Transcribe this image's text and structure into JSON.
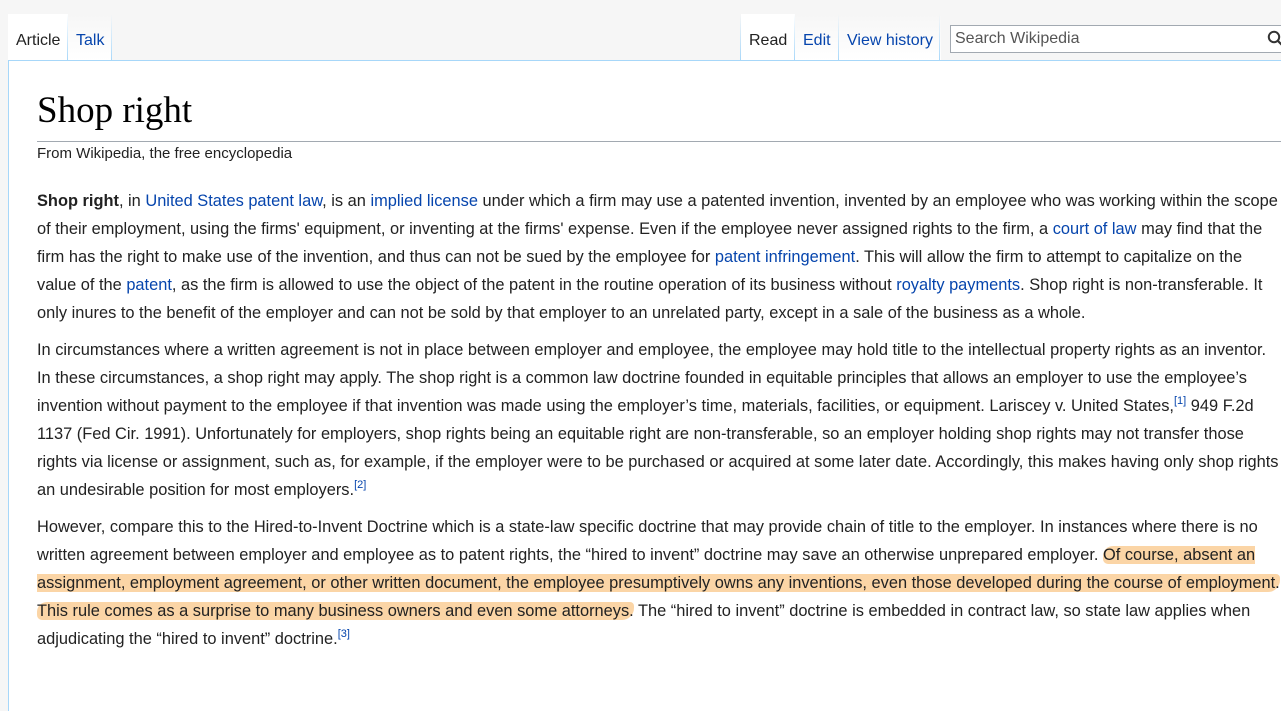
{
  "tabs": {
    "article": "Article",
    "talk": "Talk",
    "read": "Read",
    "edit": "Edit",
    "view_history": "View history"
  },
  "search": {
    "placeholder": "Search Wikipedia",
    "icon": "search-icon"
  },
  "page": {
    "title": "Shop right",
    "tagline": "From Wikipedia, the free encyclopedia"
  },
  "p1": {
    "bold": "Shop right",
    "t1": ", in ",
    "link_patent_law": "United States patent law",
    "t2": ", is an ",
    "link_implied_license": "implied license",
    "t3": " under which a firm may use a patented invention, invented by an employee who was working within the scope of their employment, using the firms' equipment, or inventing at the firms' expense. Even if the employee never assigned rights to the firm, a ",
    "link_court": "court of law",
    "t4": " may find that the firm has the right to make use of the invention, and thus can not be sued by the employee for ",
    "link_infringement": "patent infringement",
    "t5": ". This will allow the firm to attempt to capitalize on the value of the ",
    "link_patent": "patent",
    "t6": ", as the firm is allowed to use the object of the patent in the routine operation of its business without ",
    "link_royalty": "royalty payments",
    "t7": ". Shop right is non-transferable. It only inures to the benefit of the employer and can not be sold by that employer to an unrelated party, except in a sale of the business as a whole."
  },
  "p2": {
    "t1": "In circumstances where a written agreement is not in place between employer and employee, the employee may hold title to the intellectual property rights as an inventor. In these circumstances, a shop right may apply. The shop right is a common law doctrine founded in equitable principles that allows an employer to use the employee’s invention without payment to the employee if that invention was made using the employer’s time, materials, facilities, or equipment. Lariscey v. United States,",
    "ref1": "[1]",
    "t2": " 949 F.2d 1137 (Fed Cir. 1991). Unfortunately for employers, shop rights being an equitable right are non-transferable, so an employer holding shop rights may not transfer those rights via license or assignment, such as, for example, if the employer were to be purchased or acquired at some later date. Accordingly, this makes having only shop rights an undesirable position for most employers.",
    "ref2": "[2]"
  },
  "p3": {
    "t1": "However, compare this to the Hired-to-Invent Doctrine which is a state-law specific doctrine that may provide chain of title to the employer. In instances where there is no written agreement between employer and employee as to patent rights, the “hired to invent” doctrine may save an otherwise unprepared employer. ",
    "hl1": "Of course, absent an assignment, employment agreement, or other written document, the employee presumptively owns any inventions, even those developed during the course of employment.",
    "gap": " ",
    "hl2": "This rule comes as a surprise to many business owners and even some attorneys.",
    "t2": " The “hired to invent” doctrine is embedded in contract law, so state law applies when adjudicating the “hired to invent” doctrine.",
    "ref3": "[3]"
  },
  "colors": {
    "link": "#0645ad",
    "highlight": "#f8b25c",
    "tab_border": "#a7d7f9"
  }
}
